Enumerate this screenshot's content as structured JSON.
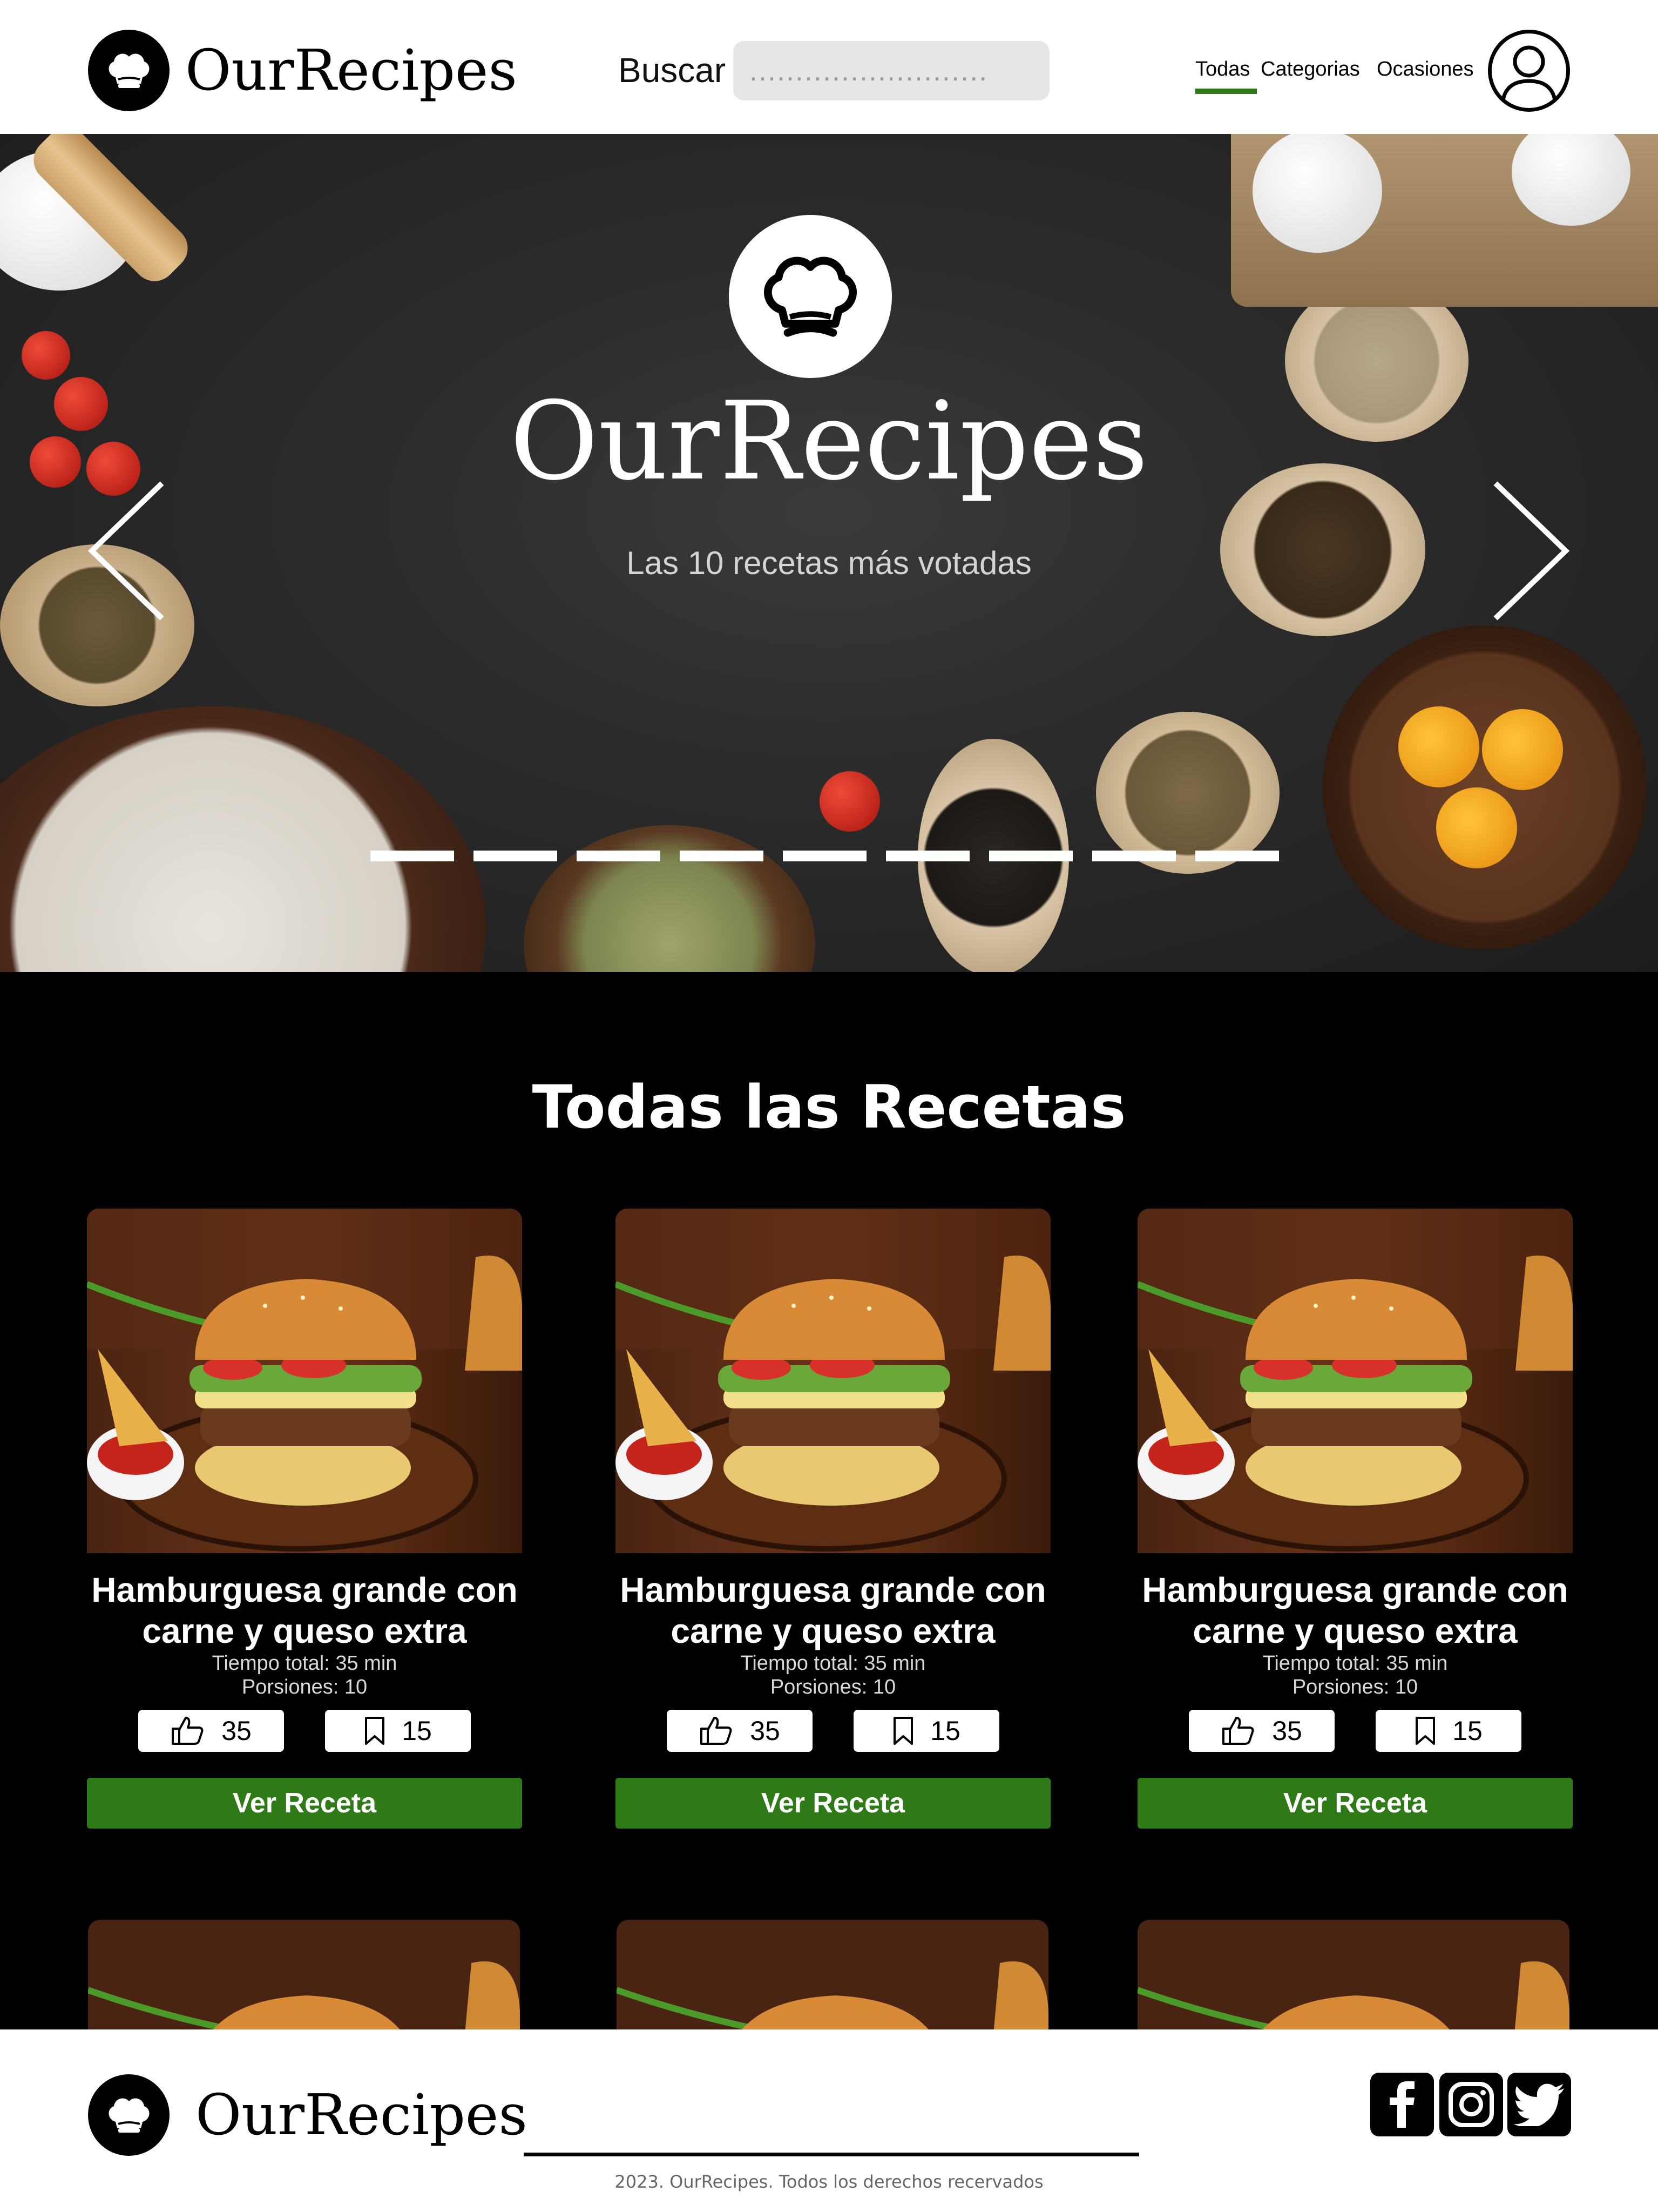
{
  "header": {
    "brand": "OurRecipes",
    "search_label": "Buscar",
    "search_placeholder": "..........................",
    "nav": [
      {
        "label": "Todas",
        "active": true
      },
      {
        "label": "Categorias",
        "active": false
      },
      {
        "label": "Ocasiones",
        "active": false
      }
    ],
    "user_icon": "user-icon"
  },
  "hero": {
    "title": "OurRecipes",
    "subtitle": "Las 10 recetas más votadas",
    "slide_count": 9,
    "prev_icon": "chevron-left-icon",
    "next_icon": "chevron-right-icon"
  },
  "recipes": {
    "section_title": "Todas las Recetas",
    "cards": [
      {
        "title": "Hamburguesa grande con carne y queso extra",
        "time": "Tiempo total: 35 min",
        "servings": "Porsiones: 10",
        "likes": "35",
        "saves": "15",
        "cta": "Ver Receta"
      },
      {
        "title": "Hamburguesa grande con carne y queso extra",
        "time": "Tiempo total: 35 min",
        "servings": "Porsiones: 10",
        "likes": "35",
        "saves": "15",
        "cta": "Ver Receta"
      },
      {
        "title": "Hamburguesa grande con carne y queso extra",
        "time": "Tiempo total: 35 min",
        "servings": "Porsiones: 10",
        "likes": "35",
        "saves": "15",
        "cta": "Ver Receta"
      }
    ]
  },
  "footer": {
    "brand": "OurRecipes",
    "copyright": "2023. OurRecipes. Todos los derechos recervados",
    "social": [
      "facebook-icon",
      "instagram-icon",
      "twitter-icon"
    ]
  },
  "colors": {
    "accent_green": "#2d7a17",
    "background": "#000000",
    "header_bg": "#ffffff",
    "search_bg": "#e6e6e6"
  }
}
